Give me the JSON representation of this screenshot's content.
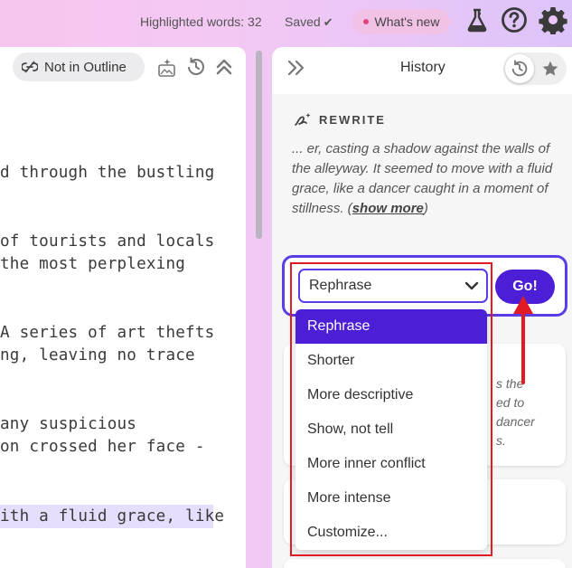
{
  "topbar": {
    "highlighted_words": "Highlighted words: 32",
    "saved": "Saved",
    "saved_check": "✔",
    "whats_new": "What's new"
  },
  "editor": {
    "not_in_outline": "Not in Outline",
    "lines": [
      "d through the bustling",
      "of tourists and locals",
      " the most perplexing",
      "A series of art thefts",
      "ng, leaving no trace",
      "any suspicious",
      "on crossed her face -",
      "ith a fluid grace, like"
    ]
  },
  "history": {
    "title": "History",
    "rewrite_label": "REWRITE",
    "rewrite_text": "... er, casting a shadow against the walls of the alleyway. It seemed to move with a fluid grace, like a dancer caught in a moment of stillness. (",
    "show_more": "show more",
    "rewrite_close": ")",
    "select_value": "Rephrase",
    "go_label": "Go!",
    "card_fragments": [
      "s the",
      "ed to",
      "dancer",
      "s."
    ]
  },
  "dropdown": {
    "options": [
      "Rephrase",
      "Shorter",
      "More descriptive",
      "Show, not tell",
      "More inner conflict",
      "More intense",
      "Customize..."
    ],
    "selected_index": 0
  },
  "colors": {
    "accent": "#4c1fd6",
    "annotation": "#e01b24",
    "highlight": "#e6defc"
  }
}
